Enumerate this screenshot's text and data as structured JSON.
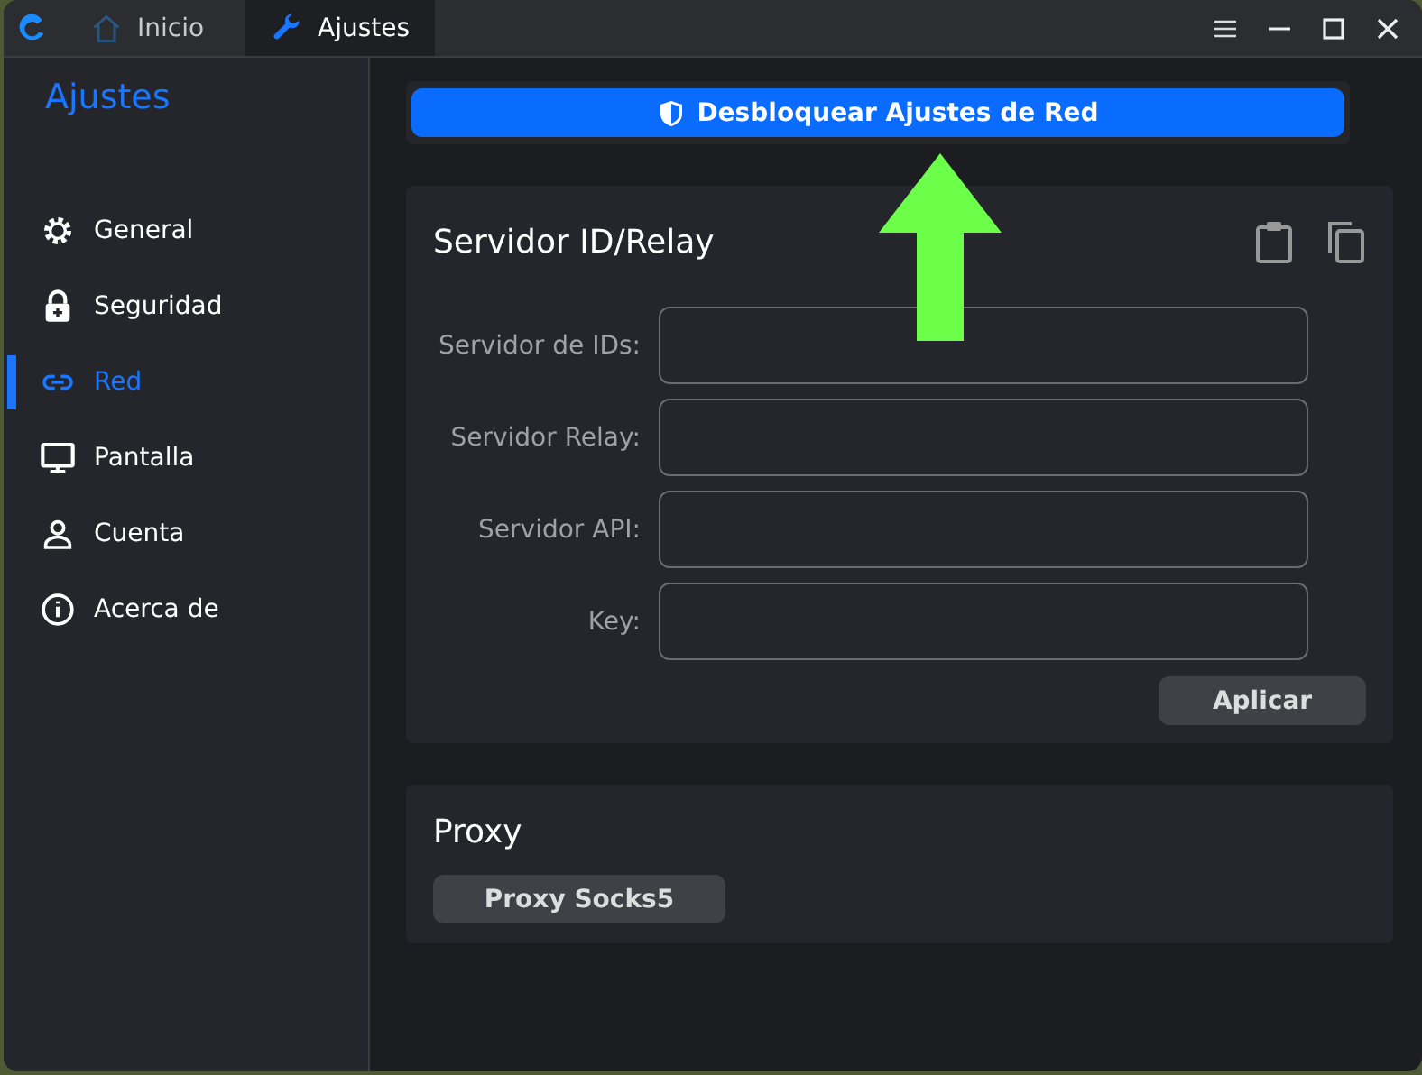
{
  "tabs": [
    {
      "label": "Inicio",
      "selected": false
    },
    {
      "label": "Ajustes",
      "selected": true
    }
  ],
  "sidebar": {
    "title": "Ajustes",
    "items": [
      {
        "label": "General",
        "selected": false
      },
      {
        "label": "Seguridad",
        "selected": false
      },
      {
        "label": "Red",
        "selected": true
      },
      {
        "label": "Pantalla",
        "selected": false
      },
      {
        "label": "Cuenta",
        "selected": false
      },
      {
        "label": "Acerca de",
        "selected": false
      }
    ]
  },
  "unlock_button": "Desbloquear Ajustes de Red",
  "server_card": {
    "title": "Servidor ID/Relay",
    "fields": [
      {
        "label": "Servidor de IDs:"
      },
      {
        "label": "Servidor Relay:"
      },
      {
        "label": "Servidor API:"
      },
      {
        "label": "Key:"
      }
    ],
    "apply_button": "Aplicar"
  },
  "proxy_card": {
    "title": "Proxy",
    "button": "Proxy Socks5"
  }
}
